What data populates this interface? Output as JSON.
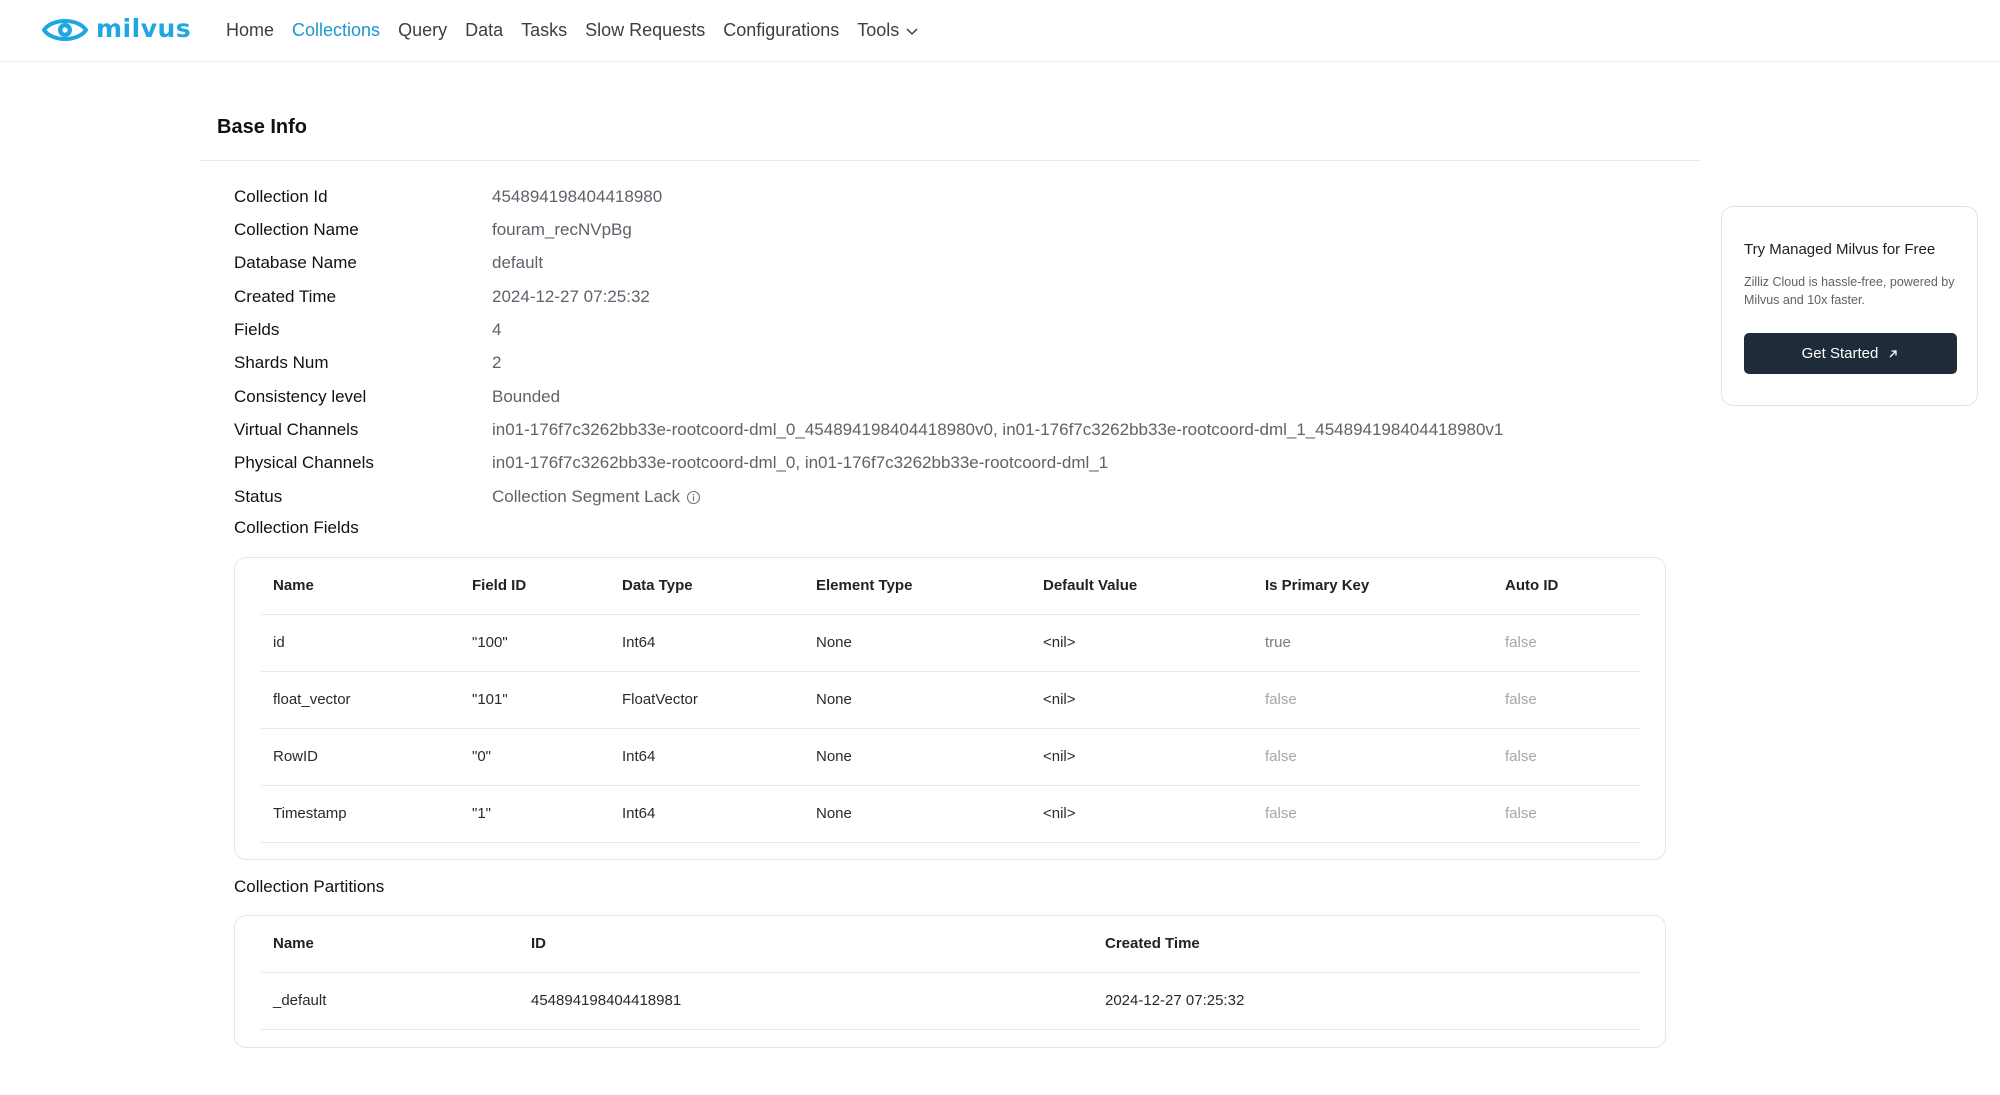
{
  "brand": {
    "name": "milvus",
    "color": "#1ea7e1"
  },
  "nav": {
    "items": [
      "Home",
      "Collections",
      "Query",
      "Data",
      "Tasks",
      "Slow Requests",
      "Configurations"
    ],
    "tools_label": "Tools",
    "active": "Collections",
    "active_color": "#1c96d4"
  },
  "base_info": {
    "title": "Base Info",
    "rows": [
      {
        "label": "Collection Id",
        "value": "454894198404418980"
      },
      {
        "label": "Collection Name",
        "value": "fouram_recNVpBg"
      },
      {
        "label": "Database Name",
        "value": "default"
      },
      {
        "label": "Created Time",
        "value": "2024-12-27 07:25:32"
      },
      {
        "label": "Fields",
        "value": "4"
      },
      {
        "label": "Shards Num",
        "value": "2"
      },
      {
        "label": "Consistency level",
        "value": "Bounded"
      },
      {
        "label": "Virtual Channels",
        "value": "in01-176f7c3262bb33e-rootcoord-dml_0_454894198404418980v0, in01-176f7c3262bb33e-rootcoord-dml_1_454894198404418980v1"
      },
      {
        "label": "Physical Channels",
        "value": "in01-176f7c3262bb33e-rootcoord-dml_0, in01-176f7c3262bb33e-rootcoord-dml_1"
      },
      {
        "label": "Status",
        "value": "Collection Segment Lack",
        "icon": "info-circle-icon"
      }
    ]
  },
  "fields": {
    "title": "Collection Fields",
    "headers": [
      "Name",
      "Field ID",
      "Data Type",
      "Element Type",
      "Default Value",
      "Is Primary Key",
      "Auto ID"
    ],
    "rows": [
      [
        "id",
        "\"100\"",
        "Int64",
        "None",
        "<nil>",
        "true",
        "false"
      ],
      [
        "float_vector",
        "\"101\"",
        "FloatVector",
        "None",
        "<nil>",
        "false",
        "false"
      ],
      [
        "RowID",
        "\"0\"",
        "Int64",
        "None",
        "<nil>",
        "false",
        "false"
      ],
      [
        "Timestamp",
        "\"1\"",
        "Int64",
        "None",
        "<nil>",
        "false",
        "false"
      ]
    ]
  },
  "partitions": {
    "title": "Collection Partitions",
    "headers": [
      "Name",
      "ID",
      "Created Time"
    ],
    "rows": [
      [
        "_default",
        "454894198404418981",
        "2024-12-27 07:25:32"
      ]
    ]
  },
  "promo": {
    "title": "Try Managed Milvus for Free",
    "description": "Zilliz Cloud is hassle-free, powered by Milvus and 10x faster.",
    "button_label": "Get Started",
    "button_color": "#202b3a"
  }
}
